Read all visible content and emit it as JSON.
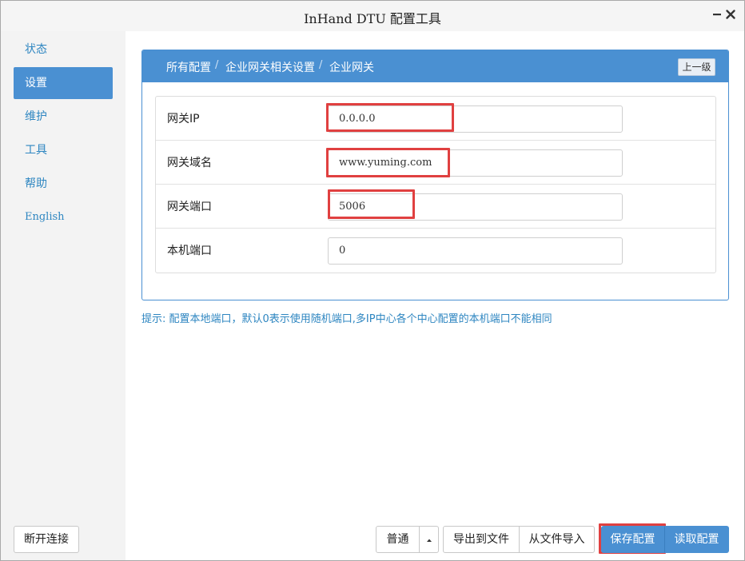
{
  "window": {
    "title": "InHand DTU 配置工具",
    "minimize_icon": "minimize-icon",
    "close_icon": "close-icon"
  },
  "sidebar": {
    "items": [
      {
        "label": "状态",
        "active": false
      },
      {
        "label": "设置",
        "active": true
      },
      {
        "label": "维护",
        "active": false
      },
      {
        "label": "工具",
        "active": false
      },
      {
        "label": "帮助",
        "active": false
      },
      {
        "label": "English",
        "active": false
      }
    ],
    "disconnect_label": "断开连接"
  },
  "breadcrumb": {
    "items": [
      "所有配置",
      "企业网关相关设置",
      "企业网关"
    ],
    "separator": "/",
    "up_label": "上一级"
  },
  "form": {
    "fields": [
      {
        "label": "网关IP",
        "value": "0.0.0.0",
        "highlighted": true
      },
      {
        "label": "网关域名",
        "value": "www.yuming.com",
        "highlighted": true
      },
      {
        "label": "网关端口",
        "value": "5006",
        "highlighted": true
      },
      {
        "label": "本机端口",
        "value": "0",
        "highlighted": false
      }
    ]
  },
  "hint": "提示: 配置本地端口，默认0表示使用随机端口,多IP中心各个中心配置的本机端口不能相同",
  "toolbar": {
    "mode_label": "普通",
    "mode_caret_icon": "caret-up-icon",
    "export_label": "导出到文件",
    "import_label": "从文件导入",
    "save_label": "保存配置",
    "read_label": "读取配置"
  },
  "colors": {
    "accent": "#4a90d2",
    "link": "#2e86c1",
    "highlight": "#e04040"
  }
}
